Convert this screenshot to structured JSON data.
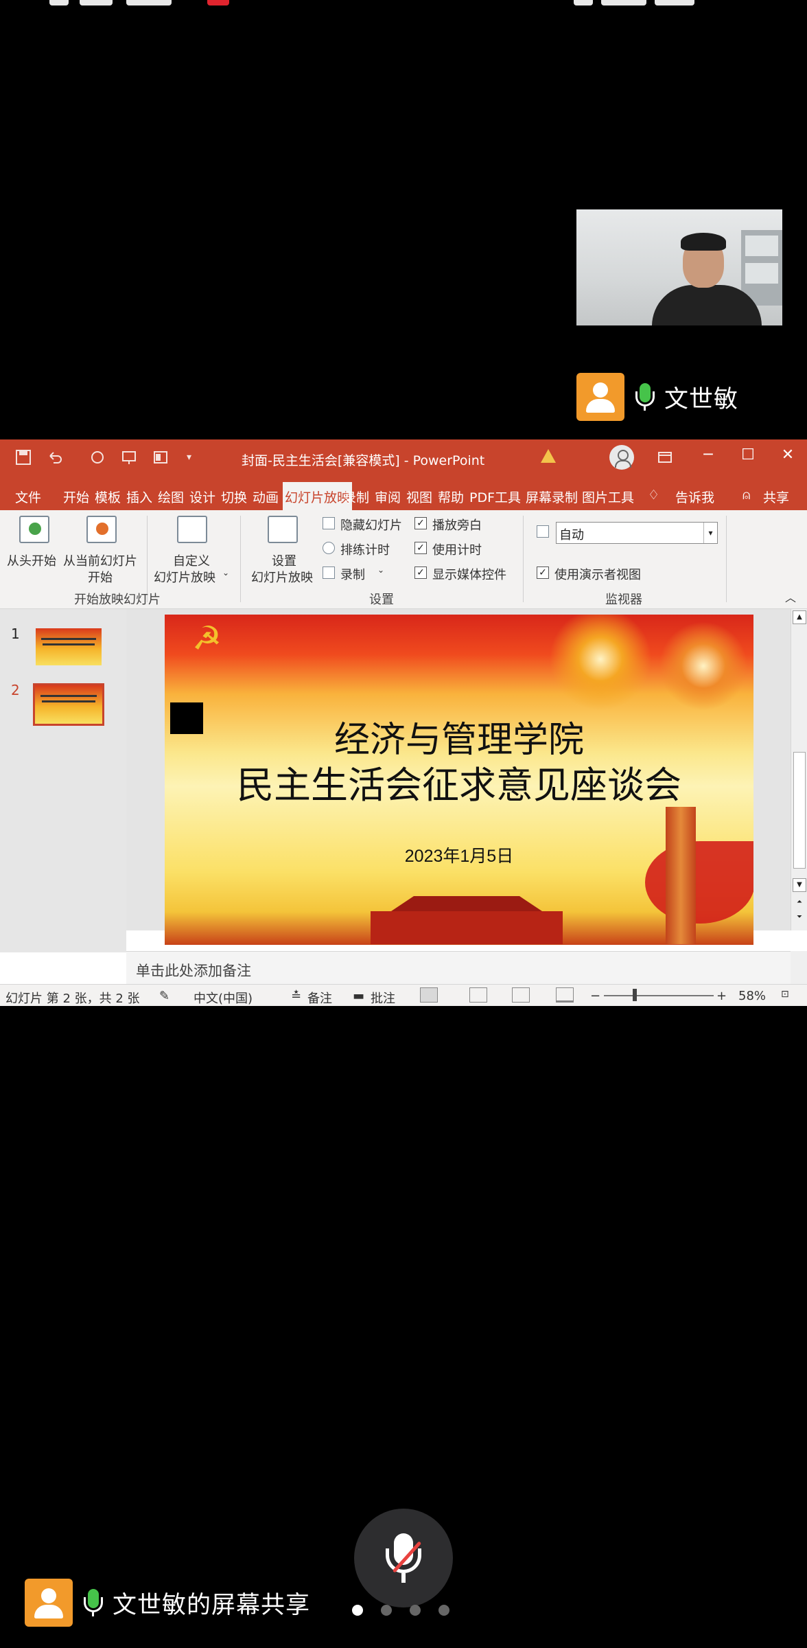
{
  "participant": {
    "name": "文世敏",
    "share_label": "文世敏的屏幕共享"
  },
  "powerpoint": {
    "window_title": "封面-民主生活会[兼容模式] - PowerPoint",
    "menu_tabs": [
      "文件",
      "开始",
      "模板",
      "插入",
      "绘图",
      "设计",
      "切换",
      "动画",
      "幻灯片放映",
      "录制",
      "审阅",
      "视图",
      "帮助",
      "PDF工具",
      "屏幕录制",
      "图片工具",
      "告诉我",
      "共享"
    ],
    "active_tab": "幻灯片放映",
    "ribbon": {
      "from_start": "从头开始",
      "from_current_1": "从当前幻灯片",
      "from_current_2": "开始",
      "custom_1": "自定义",
      "custom_2": "幻灯片放映",
      "group_start": "开始放映幻灯片",
      "setup_1": "设置",
      "setup_2": "幻灯片放映",
      "hide_slide": "隐藏幻灯片",
      "rehearse": "排练计时",
      "record": "录制",
      "play_narration": "播放旁白",
      "use_timings": "使用计时",
      "show_media_controls": "显示媒体控件",
      "group_setup": "设置",
      "monitor_value": "自动",
      "presenter_view": "使用演示者视图",
      "group_monitor": "监视器"
    },
    "thumbnails": [
      "1",
      "2"
    ],
    "slide": {
      "title_line1": "经济与管理学院",
      "title_line2": "民主生活会征求意见座谈会",
      "date": "2023年1月5日"
    },
    "notes_placeholder": "单击此处添加备注",
    "status": {
      "slide_info": "幻灯片 第 2 张，共 2 张",
      "language": "中文(中国)",
      "notes": "备注",
      "comments": "批注",
      "zoom": "58%"
    }
  },
  "colors": {
    "title_bar": "#c8442c",
    "mic_active": "#46c34a",
    "avatar": "#f29a2b",
    "mute_slash": "#e8423f"
  }
}
